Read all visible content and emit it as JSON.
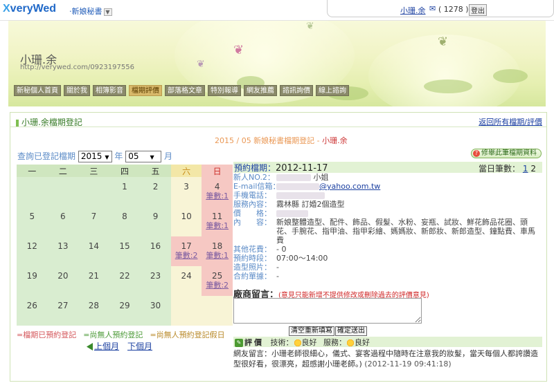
{
  "topbar": {
    "logo": "veryWed",
    "logo_x": "X",
    "category": "‧新娘秘書",
    "user_name": "小珊.余",
    "mail_count": "( 1278 )",
    "logout_label": "登出"
  },
  "banner": {
    "site_title": "小珊.余",
    "site_url": "http://verywed.com/0923197556",
    "menu": [
      {
        "label": "新秘個人首頁"
      },
      {
        "label": "關於我"
      },
      {
        "label": "相簿影音"
      },
      {
        "label": "檔期評價"
      },
      {
        "label": "部落格文章"
      },
      {
        "label": "特別報導"
      },
      {
        "label": "網友推薦"
      },
      {
        "label": "諮訊詢價"
      },
      {
        "label": "線上諮詢"
      }
    ],
    "active_menu": "檔期評價"
  },
  "page": {
    "heading": "小珊.余檔期登記",
    "back_link": "返回所有檔期/評價",
    "title_prefix": "2015 / 05 新娘秘書檔期登記 - ",
    "title_name": "小珊.余",
    "query_label": "查詢已登記檔期",
    "year_value": "2015",
    "year_unit": "年",
    "month_value": "05",
    "month_unit": "月",
    "edit_button": "修舉此筆檔期資料",
    "edit_icon": "?"
  },
  "calendar": {
    "weekdays": [
      "一",
      "二",
      "三",
      "四",
      "五",
      "六",
      "日"
    ],
    "weeks": [
      [
        {
          "d": ""
        },
        {
          "d": ""
        },
        {
          "d": ""
        },
        {
          "d": "1"
        },
        {
          "d": "2"
        },
        {
          "d": "3"
        },
        {
          "d": "4",
          "c": "筆數:1"
        }
      ],
      [
        {
          "d": "5"
        },
        {
          "d": "6"
        },
        {
          "d": "7"
        },
        {
          "d": "8"
        },
        {
          "d": "9"
        },
        {
          "d": "10"
        },
        {
          "d": "11",
          "c": "筆數:1"
        }
      ],
      [
        {
          "d": "12"
        },
        {
          "d": "13"
        },
        {
          "d": "14"
        },
        {
          "d": "15"
        },
        {
          "d": "16"
        },
        {
          "d": "17",
          "c": "筆數:2"
        },
        {
          "d": "18",
          "c": "筆數:1"
        }
      ],
      [
        {
          "d": "19"
        },
        {
          "d": "20"
        },
        {
          "d": "21"
        },
        {
          "d": "22"
        },
        {
          "d": "23"
        },
        {
          "d": "24"
        },
        {
          "d": "25",
          "c": "筆數:2"
        }
      ],
      [
        {
          "d": "26"
        },
        {
          "d": "27"
        },
        {
          "d": "28"
        },
        {
          "d": "29"
        },
        {
          "d": "30"
        },
        {
          "d": ""
        },
        {
          "d": ""
        }
      ]
    ],
    "legend": [
      "=檔期已預約登記",
      "=尚無人預約登記",
      "=尚無人預約登記假日"
    ],
    "prev_month": "上個月",
    "next_month": "下個月"
  },
  "booking": {
    "date_label": "預約檔期：",
    "date_value": "2012-11-17",
    "daily_label": "當日筆數：",
    "daily_pages": [
      "1",
      "2"
    ],
    "rows": [
      {
        "k": "新人NO.2：",
        "v": "小姐"
      },
      {
        "k": "E-mail信箱：",
        "v": "@yahoo.com.tw"
      },
      {
        "k": "手機電話：",
        "v": ""
      },
      {
        "k": "服務內容：",
        "v": "霧林縣 訂婚2個造型"
      },
      {
        "k": "價　　格：",
        "v": ""
      },
      {
        "k": "內　　容：",
        "v": "新娘整體造型、配件、飾品、假髮、水粉、妄瓶、試妝、鮮花飾品花圈、頭花、手腕花、指甲油、指甲彩繪、媽媽妝、新郎妝、新郎造型、鐘點費、車馬費"
      },
      {
        "k": "其他花費：",
        "v": "- 0"
      },
      {
        "k": "預約時段：",
        "v": "07:00～14:00"
      },
      {
        "k": "造型照片：",
        "v": "-"
      },
      {
        "k": "合約單據：",
        "v": "-"
      }
    ],
    "message_title": "廠商留言：",
    "message_note": "(意見只能新增不提供修改或刪除過去的評價意見)",
    "message_value": "",
    "reset_button": "清空重新填寫",
    "submit_button": "確定送出"
  },
  "evaluation": {
    "title": "評價",
    "tech_label": "技術：",
    "tech_value": "良好",
    "service_label": "服務：",
    "service_value": "良好",
    "friend_message": "網友留言：小珊老師很細心，儀式、宴客過程中隨時在注意我的妝髮，當天每個人都誇讚造型很好看，很漂亮，超感謝小珊老師。)",
    "timestamp": "(2012-11-19 09:41:18)"
  }
}
